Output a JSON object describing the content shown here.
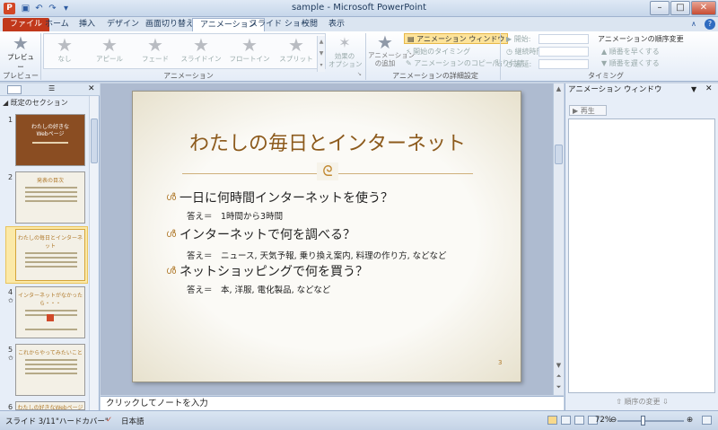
{
  "window": {
    "title": "sample - Microsoft PowerPoint",
    "app_letter": "P"
  },
  "ribbon": {
    "tabs": [
      "ファイル",
      "ホーム",
      "挿入",
      "デザイン",
      "画面切り替え",
      "アニメーション",
      "スライド ショー",
      "校閲",
      "表示"
    ],
    "active_tab": "アニメーション",
    "preview": {
      "label": "プレビュー",
      "group": "プレビュー"
    },
    "animation_gallery": {
      "items": [
        "なし",
        "アピール",
        "フェード",
        "スライドイン",
        "フロートイン",
        "スプリット"
      ],
      "group": "アニメーション"
    },
    "effect_options": "効果の\nオプション",
    "advanced": {
      "add_animation": "アニメーション\nの追加",
      "animation_pane": "アニメーション ウィンドウ",
      "trigger": "開始のタイミング",
      "painter": "アニメーションのコピー/貼り付け",
      "group": "アニメーションの詳細設定"
    },
    "timing": {
      "start": "開始:",
      "duration": "継続時間:",
      "delay": "遅延:",
      "reorder_title": "アニメーションの順序変更",
      "move_earlier": "順番を早くする",
      "move_later": "順番を遅くする",
      "group": "タイミング"
    }
  },
  "left_panel": {
    "section": "既定のセクション",
    "thumbnails": [
      {
        "num": "1",
        "title": "わたしの好きな\nWebページ"
      },
      {
        "num": "2",
        "title": "発表の目次"
      },
      {
        "num": "3",
        "title": "わたしの毎日とインターネット"
      },
      {
        "num": "4",
        "title": "インターネットがなかったら・・・"
      },
      {
        "num": "5",
        "title": "これからやってみたいこと"
      },
      {
        "num": "6",
        "title": "わたしの好きなWebページ"
      }
    ]
  },
  "slide": {
    "title": "わたしの毎日とインターネット",
    "ornament": "ᘓ",
    "bullets": [
      {
        "text": "一日に何時間インターネットを使う？",
        "answer": "答え＝　1時間から3時間"
      },
      {
        "text": "インターネットで何を調べる？",
        "answer": "答え＝　ニュース, 天気予報, 乗り換え案内, 料理の作り方, などなど"
      },
      {
        "text": "ネットショッピングで何を買う？",
        "answer": "答え＝　本, 洋服, 電化製品, などなど"
      }
    ],
    "number": "3"
  },
  "notes": {
    "placeholder": "クリックしてノートを入力"
  },
  "animation_pane": {
    "title": "アニメーション ウィンドウ",
    "play": "再生",
    "reorder": "順序の変更"
  },
  "status": {
    "slide_info": "スライド 3/11",
    "theme": "\"ハードカバー\"",
    "language": "日本語",
    "zoom": "72%"
  }
}
